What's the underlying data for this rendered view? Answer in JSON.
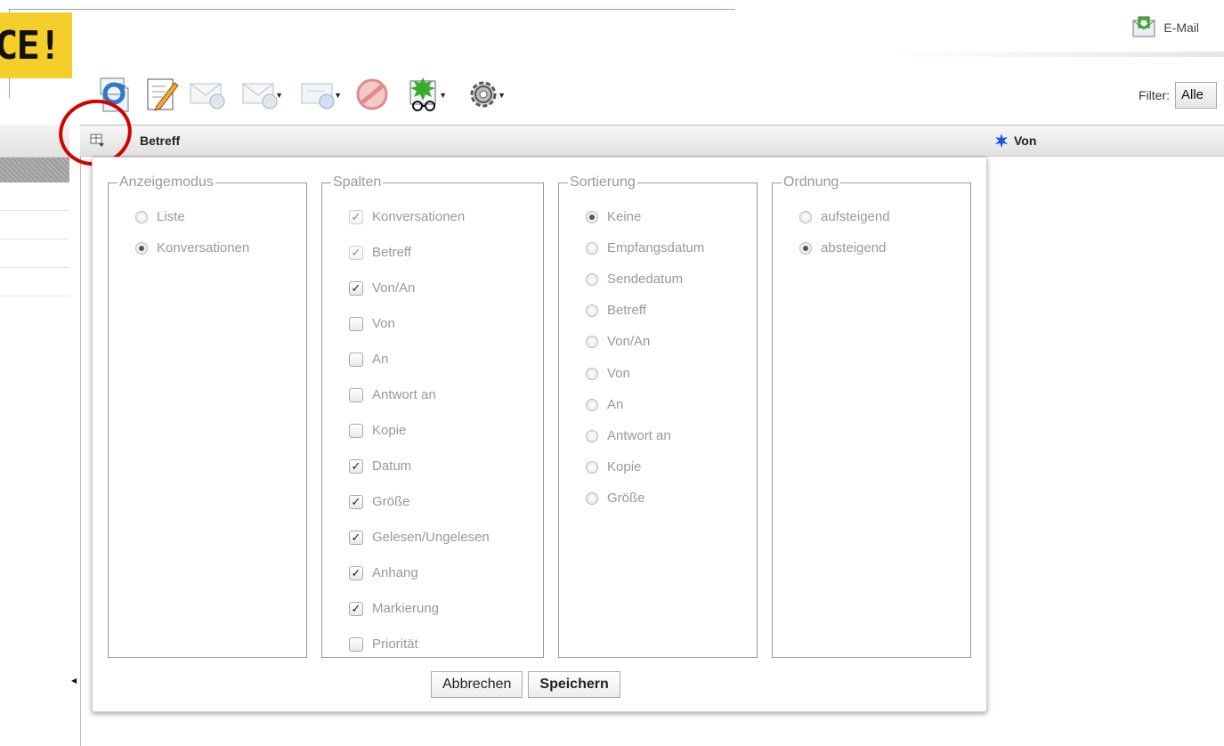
{
  "header": {
    "logo_text": "CE!",
    "email_label": "E-Mail",
    "filter_label": "Filter:",
    "filter_value": "Alle"
  },
  "toolbar": {
    "icons": [
      "refresh-icon",
      "compose-icon",
      "reply-icon",
      "reply-all-icon",
      "forward-icon",
      "delete-icon",
      "mark-icon",
      "settings-icon"
    ]
  },
  "list_header": {
    "subject": "Betreff",
    "from": "Von"
  },
  "dialog": {
    "display_mode": {
      "legend": "Anzeigemodus",
      "options": [
        {
          "label": "Liste",
          "selected": false
        },
        {
          "label": "Konversationen",
          "selected": true
        }
      ]
    },
    "columns": {
      "legend": "Spalten",
      "options": [
        {
          "label": "Konversationen",
          "checked": true,
          "disabled": true
        },
        {
          "label": "Betreff",
          "checked": true,
          "disabled": true
        },
        {
          "label": "Von/An",
          "checked": true,
          "disabled": false
        },
        {
          "label": "Von",
          "checked": false,
          "disabled": false
        },
        {
          "label": "An",
          "checked": false,
          "disabled": false
        },
        {
          "label": "Antwort an",
          "checked": false,
          "disabled": false
        },
        {
          "label": "Kopie",
          "checked": false,
          "disabled": false
        },
        {
          "label": "Datum",
          "checked": true,
          "disabled": false
        },
        {
          "label": "Größe",
          "checked": true,
          "disabled": false
        },
        {
          "label": "Gelesen/Ungelesen",
          "checked": true,
          "disabled": false
        },
        {
          "label": "Anhang",
          "checked": true,
          "disabled": false
        },
        {
          "label": "Markierung",
          "checked": true,
          "disabled": false
        },
        {
          "label": "Priorität",
          "checked": false,
          "disabled": false
        }
      ]
    },
    "sorting": {
      "legend": "Sortierung",
      "options": [
        {
          "label": "Keine",
          "selected": true
        },
        {
          "label": "Empfangsdatum",
          "selected": false
        },
        {
          "label": "Sendedatum",
          "selected": false
        },
        {
          "label": "Betreff",
          "selected": false
        },
        {
          "label": "Von/An",
          "selected": false
        },
        {
          "label": "Von",
          "selected": false
        },
        {
          "label": "An",
          "selected": false
        },
        {
          "label": "Antwort an",
          "selected": false
        },
        {
          "label": "Kopie",
          "selected": false
        },
        {
          "label": "Größe",
          "selected": false
        }
      ]
    },
    "order": {
      "legend": "Ordnung",
      "options": [
        {
          "label": "aufsteigend",
          "selected": false
        },
        {
          "label": "absteigend",
          "selected": true
        }
      ]
    },
    "cancel_label": "Abbrechen",
    "save_label": "Speichern"
  },
  "colors": {
    "annotation_circle": "#d40000",
    "logo_bg": "#f6ce2a",
    "von_star": "#1a56d6"
  }
}
